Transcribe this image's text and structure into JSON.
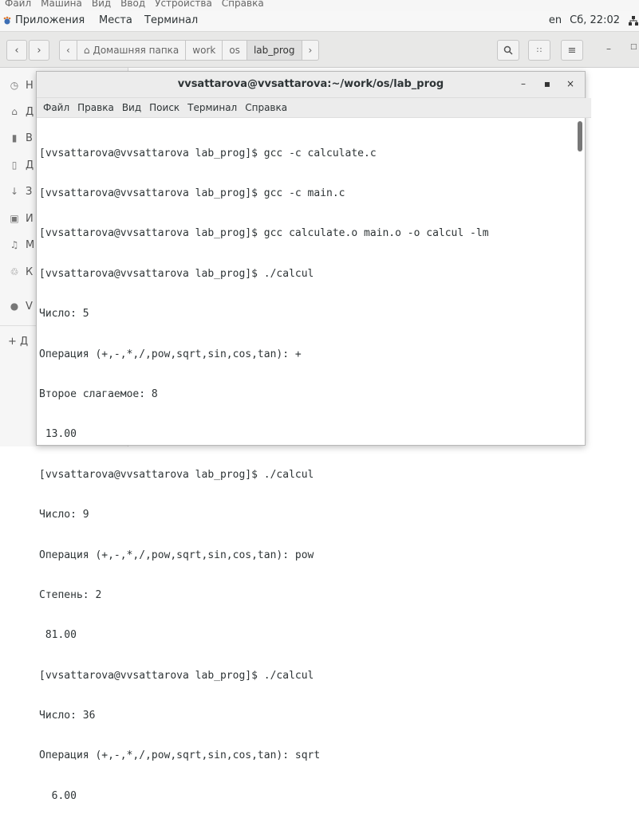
{
  "vm_menubar": {
    "items": [
      "Файл",
      "Машина",
      "Вид",
      "Ввод",
      "Устройства",
      "Справка"
    ]
  },
  "topbar": {
    "applications": "Приложения",
    "places": "Места",
    "terminal": "Терминал",
    "lang": "en",
    "clock": "Сб, 22:02",
    "network_icon": "network-icon"
  },
  "files": {
    "path": [
      "Домашняя папка",
      "work",
      "os",
      "lab_prog"
    ],
    "sidebar_partial": [
      "Н",
      "Д",
      "В",
      "Д",
      "З",
      "И",
      "М",
      "К",
      "V",
      "+ Д"
    ],
    "icons": {
      "back": "back-icon",
      "forward": "forward-icon",
      "home": "home-icon",
      "search": "search-icon",
      "view": "view-toggle-icon",
      "menu": "menu-icon"
    }
  },
  "terminal": {
    "title": "vvsattarova@vvsattarova:~/work/os/lab_prog",
    "menu": [
      "Файл",
      "Правка",
      "Вид",
      "Поиск",
      "Терминал",
      "Справка"
    ],
    "lines": [
      "[vvsattarova@vvsattarova lab_prog]$ gcc -c calculate.c",
      "[vvsattarova@vvsattarova lab_prog]$ gcc -c main.c",
      "[vvsattarova@vvsattarova lab_prog]$ gcc calculate.o main.o -o calcul -lm",
      "[vvsattarova@vvsattarova lab_prog]$ ./calcul",
      "Число: 5",
      "Операция (+,-,*,/,pow,sqrt,sin,cos,tan): +",
      "Второе слагаемое: 8",
      " 13.00",
      "[vvsattarova@vvsattarova lab_prog]$ ./calcul",
      "Число: 9",
      "Операция (+,-,*,/,pow,sqrt,sin,cos,tan): pow",
      "Степень: 2",
      " 81.00",
      "[vvsattarova@vvsattarova lab_prog]$ ./calcul",
      "Число: 36",
      "Операция (+,-,*,/,pow,sqrt,sin,cos,tan): sqrt",
      "  6.00"
    ]
  }
}
